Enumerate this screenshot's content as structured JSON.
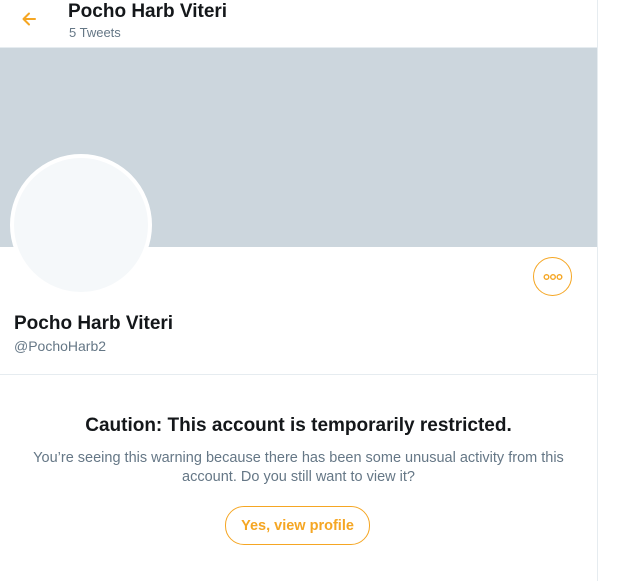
{
  "header": {
    "title": "Pocho Harb Viteri",
    "tweet_count": "5 Tweets",
    "back_icon": "arrow-left-icon"
  },
  "profile": {
    "name": "Pocho Harb Viteri",
    "handle": "@PochoHarb2",
    "more_icon": "more-horizontal-icon"
  },
  "warning": {
    "title": "Caution: This account is temporarily restricted.",
    "body": "You’re seeing this warning because there has been some unusual activity from this account. Do you still want to view it?",
    "button_label": "Yes, view profile"
  },
  "colors": {
    "accent": "#f5a623",
    "banner": "#ccd6dd",
    "avatar": "#f5f8fa",
    "text_primary": "#14171a",
    "text_secondary": "#657786"
  }
}
